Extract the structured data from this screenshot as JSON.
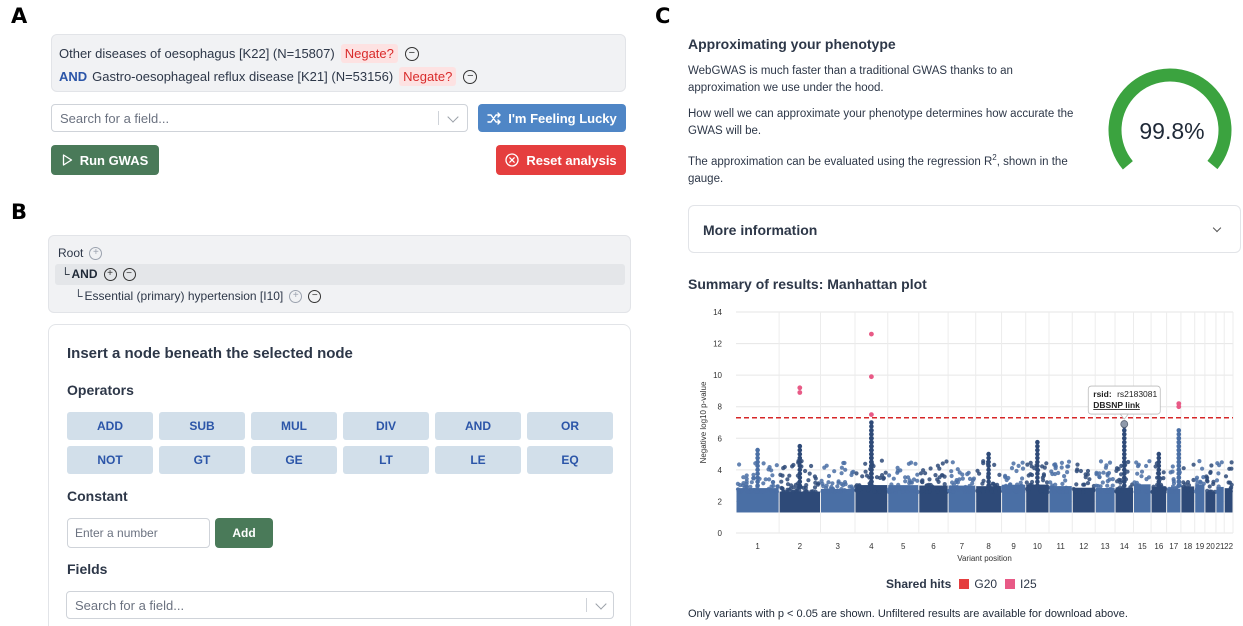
{
  "panels": {
    "a": "A",
    "b": "B",
    "c": "C"
  },
  "phenotype": {
    "rows": [
      {
        "operator": "",
        "label": "Other diseases of oesophagus [K22] (N=15807)",
        "negate_label": "Negate?"
      },
      {
        "operator": "AND",
        "label": "Gastro-oesophageal reflux disease [K21] (N=53156)",
        "negate_label": "Negate?"
      }
    ]
  },
  "field_search": {
    "placeholder": "Search for a field..."
  },
  "buttons": {
    "lucky": "I'm Feeling Lucky",
    "run": "Run GWAS",
    "reset": "Reset analysis",
    "add": "Add"
  },
  "tree": {
    "root": "Root",
    "and": "AND",
    "leaf": "Essential (primary) hypertension [I10]"
  },
  "node_card": {
    "title": "Insert a node beneath the selected node",
    "operators_heading": "Operators",
    "operators": [
      "ADD",
      "SUB",
      "MUL",
      "DIV",
      "AND",
      "OR",
      "NOT",
      "GT",
      "GE",
      "LT",
      "LE",
      "EQ"
    ],
    "constant_heading": "Constant",
    "constant_placeholder": "Enter a number",
    "fields_heading": "Fields",
    "fields_placeholder": "Search for a field..."
  },
  "approx": {
    "title": "Approximating your phenotype",
    "para1": "WebGWAS is much faster than a traditional GWAS thanks to an approximation we use under the hood.",
    "para2": "How well we can approximate your phenotype determines how accurate the GWAS will be.",
    "para3_prefix": "The approximation can be evaluated using the regression R",
    "para3_sup": "2",
    "para3_suffix": ", shown in the gauge.",
    "gauge_value": "99.8%",
    "gauge_fraction": 0.998,
    "gauge_color": "#3ba33f"
  },
  "more_info": {
    "label": "More information"
  },
  "manhattan": {
    "title": "Summary of results: Manhattan plot",
    "ylabel": "Negative log10 p-value",
    "xlabel": "Variant position",
    "tooltip": {
      "rsid_label": "rsid:",
      "rsid": "rs2183081",
      "link": "DBSNP link"
    },
    "legend_title": "Shared hits",
    "footnote": "Only variants with p < 0.05 are shown. Unfiltered results are available for download above."
  },
  "chart_data": {
    "type": "scatter",
    "title": "Summary of results: Manhattan plot",
    "xlabel": "Variant position",
    "ylabel": "Negative log10 p-value",
    "ylim": [
      0,
      14
    ],
    "yticks": [
      0,
      2,
      4,
      6,
      8,
      10,
      12,
      14
    ],
    "chromosomes": [
      "1",
      "2",
      "3",
      "4",
      "5",
      "6",
      "7",
      "8",
      "9",
      "10",
      "11",
      "12",
      "13",
      "14",
      "15",
      "16",
      "17",
      "18",
      "19",
      "20",
      "21",
      "22"
    ],
    "chromosome_weights": [
      25,
      24,
      20,
      19,
      18,
      17,
      16,
      15,
      14,
      13.5,
      13.5,
      13.3,
      11.5,
      10.7,
      10.2,
      9,
      8.3,
      8,
      5.9,
      6.4,
      4.8,
      5.1
    ],
    "significance_threshold": 7.3,
    "grid": true,
    "series": [
      {
        "name": "G20",
        "color": "#e53e3e"
      },
      {
        "name": "I25",
        "color": "#e85a86"
      }
    ],
    "hits": [
      {
        "chr": "2",
        "y": 9.2,
        "series": "I25"
      },
      {
        "chr": "2",
        "y": 8.9,
        "series": "I25"
      },
      {
        "chr": "4",
        "y": 12.6,
        "series": "I25"
      },
      {
        "chr": "4",
        "y": 9.9,
        "series": "I25"
      },
      {
        "chr": "4",
        "y": 7.5,
        "series": "I25"
      },
      {
        "chr": "17",
        "y": 8.2,
        "series": "I25"
      },
      {
        "chr": "17",
        "y": 8.0,
        "series": "I25"
      }
    ],
    "peaks": [
      {
        "chr": "1",
        "y": 5.4
      },
      {
        "chr": "2",
        "y": 5.5
      },
      {
        "chr": "4",
        "y": 7.2
      },
      {
        "chr": "4",
        "y": 6.5
      },
      {
        "chr": "4",
        "y": 6.0
      },
      {
        "chr": "8",
        "y": 5.2
      },
      {
        "chr": "10",
        "y": 5.8
      },
      {
        "chr": "14",
        "y": 6.9
      },
      {
        "chr": "16",
        "y": 5.0
      },
      {
        "chr": "17",
        "y": 6.5
      },
      {
        "chr": "17",
        "y": 6.0
      }
    ],
    "highlighted": {
      "chr": "14",
      "y": 6.9,
      "rsid": "rs2183081"
    }
  }
}
